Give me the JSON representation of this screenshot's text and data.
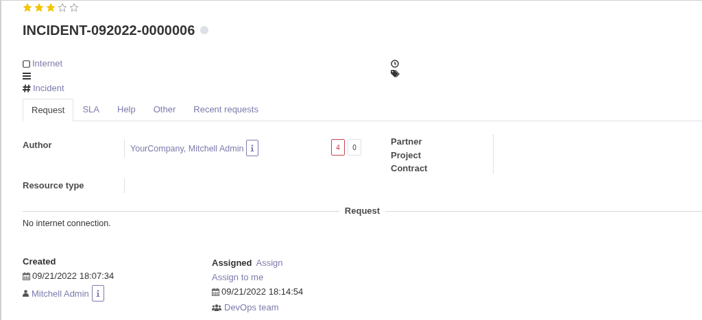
{
  "rating": {
    "stars": 3
  },
  "title": "INCIDENT-092022-0000006",
  "meta": [
    {
      "kind": "category",
      "text": "Internet"
    },
    {
      "kind": "menu"
    },
    {
      "kind": "type",
      "text": "Incident"
    }
  ],
  "tabs": [
    {
      "label": "Request",
      "selected": true
    },
    {
      "label": "SLA",
      "selected": false
    },
    {
      "label": "Help",
      "selected": false
    },
    {
      "label": "Other",
      "selected": false
    },
    {
      "label": "Recent requests",
      "selected": false
    }
  ],
  "author": {
    "label": "Author",
    "value": "YourCompany, Mitchell Admin",
    "counts": [
      {
        "text": "4",
        "kind": "open"
      },
      {
        "text": "0",
        "kind": "closed"
      }
    ]
  },
  "resource_type": {
    "label": "Resource type"
  },
  "right_fields": [
    "Partner",
    "Project",
    "Contract"
  ],
  "request_section": {
    "title": "Request",
    "text": "No internet connection."
  },
  "created": {
    "label": "Created",
    "date": "09/21/2022 18:07:34",
    "user": "Mitchell Admin"
  },
  "assigned": {
    "label": "Assigned",
    "action": "Assign",
    "assign_to_me": "Assign to me",
    "date": "09/21/2022 18:14:54",
    "team": "DevOps team"
  }
}
